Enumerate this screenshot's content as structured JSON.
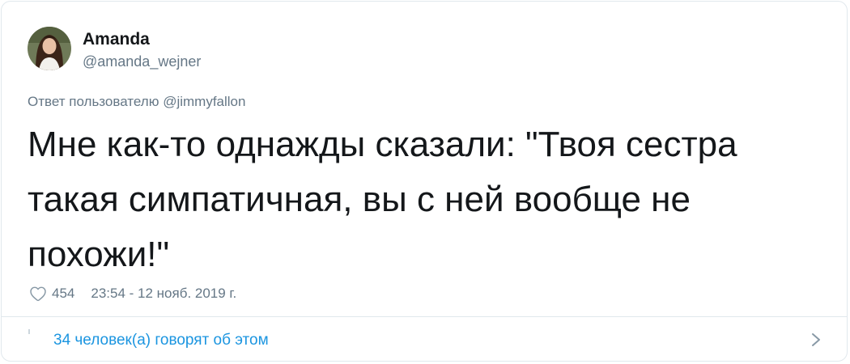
{
  "author": {
    "name": "Amanda",
    "handle": "@amanda_wejner"
  },
  "reply": {
    "prefix": "Ответ пользователю",
    "mention": "@jimmyfallon"
  },
  "tweet": {
    "text": "Мне как-то однажды сказали: \"Твоя сестра такая симпатичная, вы с ней вообще не похожи!\""
  },
  "meta": {
    "likes": "454",
    "timestamp": "23:54 - 12 нояб. 2019 г."
  },
  "footer": {
    "conversation_label": "34 человек(а) говорят об этом"
  },
  "colors": {
    "text_primary": "#14171a",
    "text_secondary": "#657786",
    "link": "#1b95e0",
    "border": "#e1e8ed"
  },
  "icons": {
    "like": "heart-icon",
    "expand": "chevron-right-icon"
  }
}
